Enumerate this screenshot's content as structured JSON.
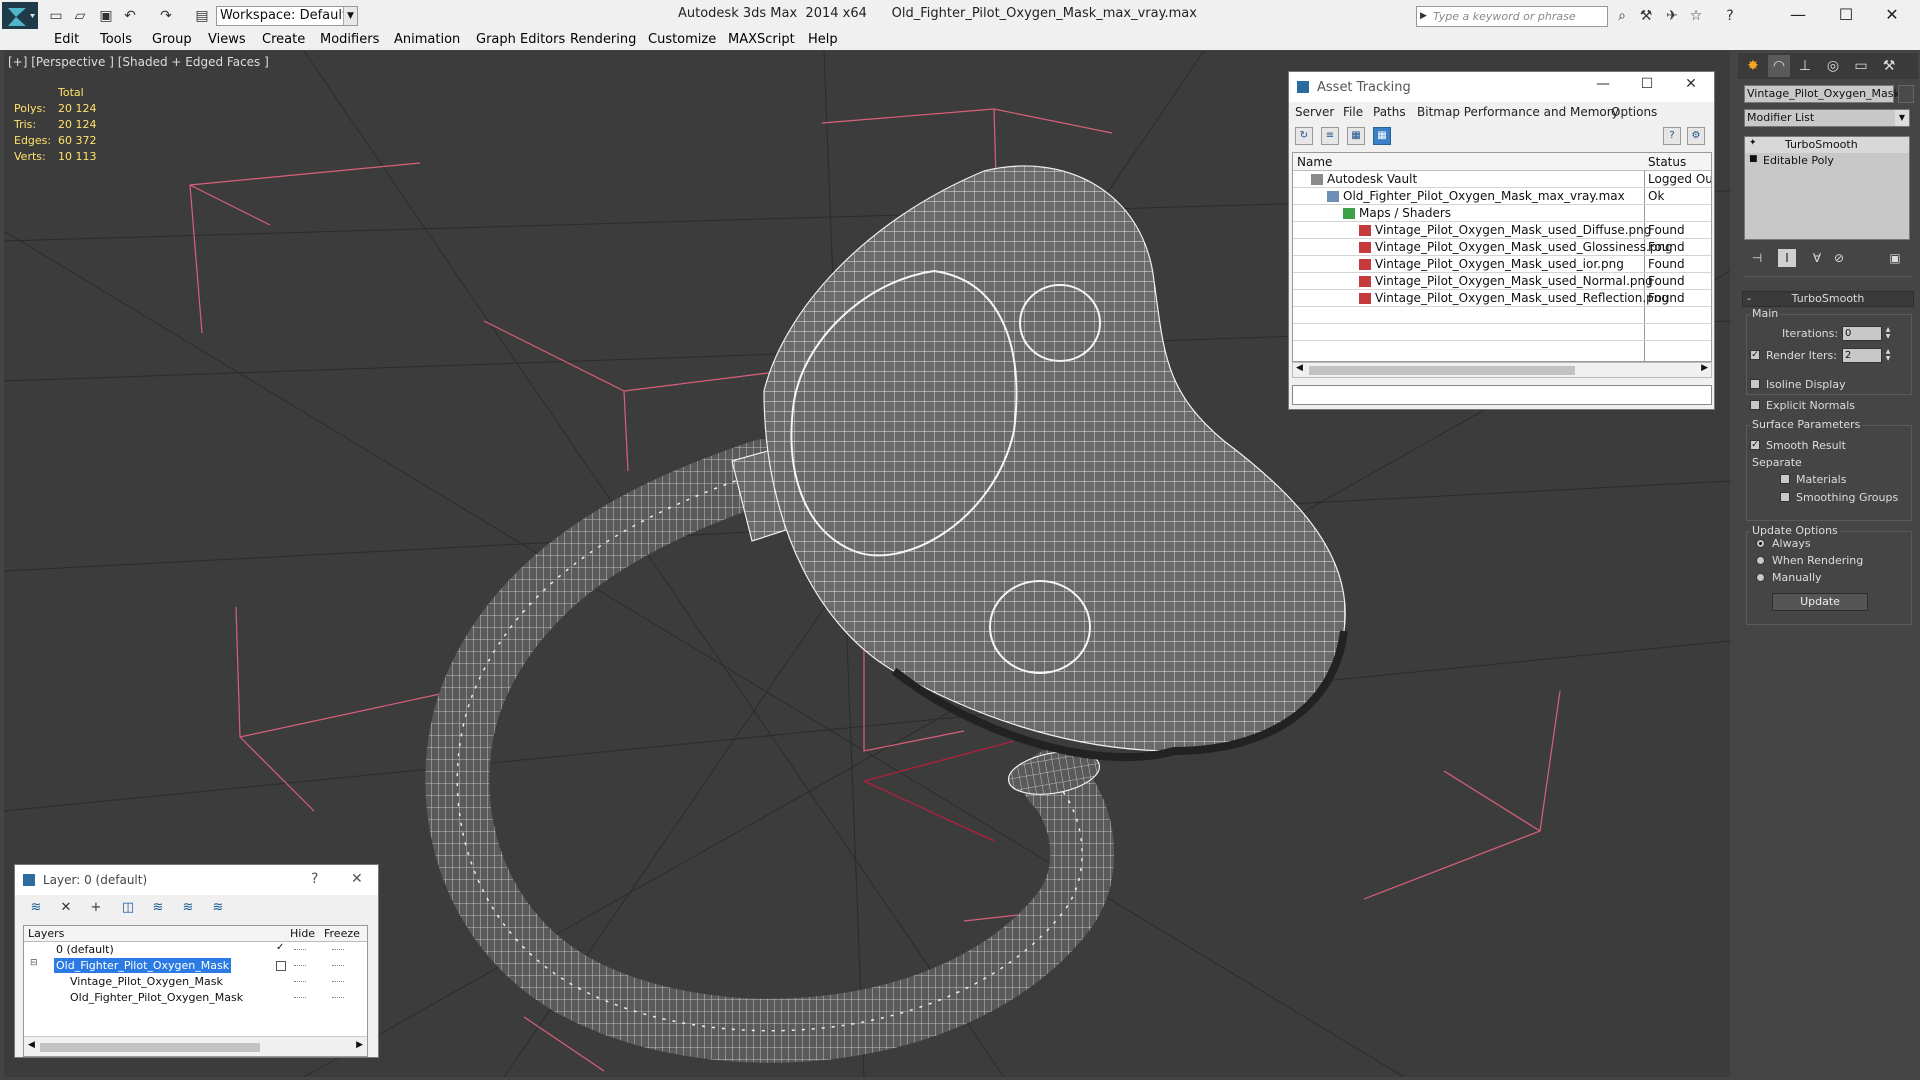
{
  "app": {
    "title": "Autodesk 3ds Max  2014 x64      Old_Fighter_Pilot_Oxygen_Mask_max_vray.max",
    "workspace": "Workspace: Default",
    "search_placeholder": "Type a keyword or phrase"
  },
  "menu": [
    "Edit",
    "Tools",
    "Group",
    "Views",
    "Create",
    "Modifiers",
    "Animation",
    "Graph Editors",
    "Rendering",
    "Customize",
    "MAXScript",
    "Help"
  ],
  "viewport": {
    "label": "[+] [Perspective ] [Shaded + Edged Faces ]",
    "stats_header": "Total",
    "stats": [
      {
        "label": "Polys:",
        "value": "20 124"
      },
      {
        "label": "Tris:",
        "value": "20 124"
      },
      {
        "label": "Edges:",
        "value": "60 372"
      },
      {
        "label": "Verts:",
        "value": "10 113"
      }
    ]
  },
  "asset_tracking": {
    "title": "Asset Tracking",
    "menu": [
      "Server",
      "File",
      "Paths",
      "Bitmap Performance and Memory",
      "Options"
    ],
    "col_name": "Name",
    "col_status": "Status",
    "rows": [
      {
        "name": "Autodesk Vault",
        "status": "Logged Out",
        "indent": 0
      },
      {
        "name": "Old_Fighter_Pilot_Oxygen_Mask_max_vray.max",
        "status": "Ok",
        "indent": 1
      },
      {
        "name": "Maps / Shaders",
        "status": "",
        "indent": 2
      },
      {
        "name": "Vintage_Pilot_Oxygen_Mask_used_Diffuse.png",
        "status": "Found",
        "indent": 3
      },
      {
        "name": "Vintage_Pilot_Oxygen_Mask_used_Glossiness.png",
        "status": "Found",
        "indent": 3
      },
      {
        "name": "Vintage_Pilot_Oxygen_Mask_used_ior.png",
        "status": "Found",
        "indent": 3
      },
      {
        "name": "Vintage_Pilot_Oxygen_Mask_used_Normal.png",
        "status": "Found",
        "indent": 3
      },
      {
        "name": "Vintage_Pilot_Oxygen_Mask_used_Reflection.png",
        "status": "Found",
        "indent": 3
      }
    ]
  },
  "command_panel": {
    "object_name": "Vintage_Pilot_Oxygen_Mask",
    "modifier_list": "Modifier List",
    "stack": [
      "TurboSmooth",
      "Editable Poly"
    ],
    "rollout_title": "TurboSmooth",
    "main_label": "Main",
    "iterations_label": "Iterations:",
    "iterations_value": "0",
    "render_iters_label": "Render Iters:",
    "render_iters_value": "2",
    "isoline_label": "Isoline Display",
    "explicit_normals_label": "Explicit Normals",
    "surface_label": "Surface Parameters",
    "smooth_result_label": "Smooth Result",
    "separate_label": "Separate",
    "materials_label": "Materials",
    "smoothing_groups_label": "Smoothing Groups",
    "update_options_label": "Update Options",
    "always_label": "Always",
    "when_rendering_label": "When Rendering",
    "manually_label": "Manually",
    "update_button": "Update"
  },
  "layer_window": {
    "title": "Layer: 0 (default)",
    "col_layers": "Layers",
    "col_hide": "Hide",
    "col_freeze": "Freeze",
    "rows": [
      {
        "name": "0 (default)",
        "selected": false
      },
      {
        "name": "Old_Fighter_Pilot_Oxygen_Mask",
        "selected": true
      },
      {
        "name": "Vintage_Pilot_Oxygen_Mask",
        "selected": false
      },
      {
        "name": "Old_Fighter_Pilot_Oxygen_Mask",
        "selected": false
      }
    ]
  },
  "colors": {
    "viewport_bg": "#3c3c3c",
    "stats_text": "#ffe26a",
    "bounding_box": "#d9607a",
    "selection_blue": "#2c7be5"
  }
}
